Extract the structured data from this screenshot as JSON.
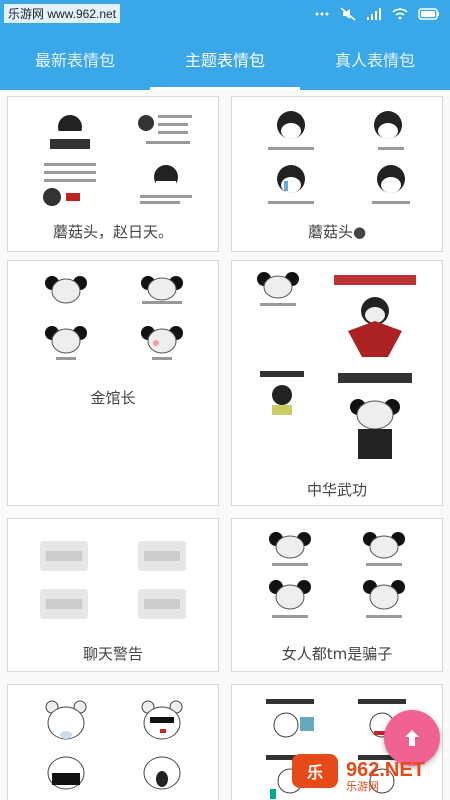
{
  "status": {
    "watermark": "乐游网 www.962.net"
  },
  "tabs": [
    {
      "label": "最新表情包",
      "active": false
    },
    {
      "label": "主题表情包",
      "active": true
    },
    {
      "label": "真人表情包",
      "active": false
    }
  ],
  "cards": [
    {
      "title": "蘑菇头，赵日天。"
    },
    {
      "title": "蘑菇头●"
    },
    {
      "title": "金馆长"
    },
    {
      "title": "中华武功"
    },
    {
      "title": "聊天警告"
    },
    {
      "title": "女人都tm是骗子"
    },
    {
      "title": ""
    },
    {
      "title": ""
    }
  ],
  "fab": {
    "icon": "arrow-up-icon"
  },
  "watermark_logo": {
    "text": "962.NET",
    "subtext": "乐游网"
  },
  "colors": {
    "accent": "#3aa7e9",
    "fab": "#f06292"
  }
}
